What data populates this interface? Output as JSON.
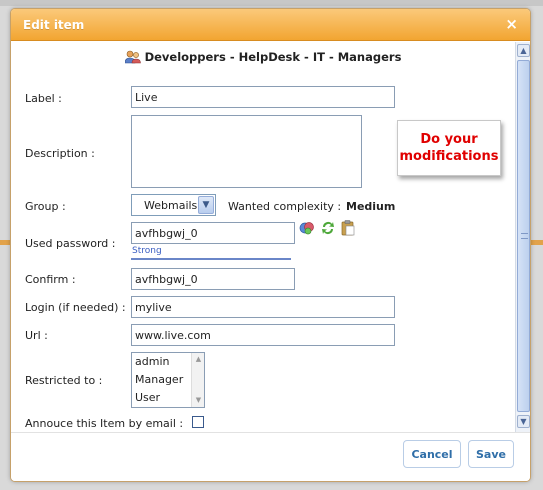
{
  "dialog": {
    "title": "Edit item",
    "close_glyph": "×",
    "header": "Developpers - HelpDesk - IT - Managers",
    "header_icon": "users-icon"
  },
  "form": {
    "label": {
      "caption": "Label :",
      "value": "Live"
    },
    "description": {
      "caption": "Description :",
      "value": ""
    },
    "group": {
      "caption": "Group :",
      "selected": "Webmails"
    },
    "complexity": {
      "caption": "Wanted complexity :",
      "value": "Medium"
    },
    "used_password": {
      "caption": "Used password :",
      "value": "avfhbgwj_0",
      "strength": "Strong",
      "strength_fraction": 1.0
    },
    "confirm": {
      "caption": "Confirm :",
      "value": "avfhbgwj_0"
    },
    "login": {
      "caption": "Login (if needed) :",
      "value": "mylive"
    },
    "url": {
      "caption": "Url :",
      "value": "www.live.com"
    },
    "restricted": {
      "caption": "Restricted to :",
      "options": [
        "admin",
        "Manager",
        "User"
      ]
    },
    "announce": {
      "caption": "Annouce this Item by email :",
      "checked": false
    }
  },
  "callout": {
    "line1": "Do your",
    "line2": "modifications"
  },
  "buttons": {
    "cancel": "Cancel",
    "save": "Save"
  },
  "colors": {
    "titlebar": "#f2a531",
    "callout_text": "#e00000",
    "button_text": "#2f6ea8"
  }
}
